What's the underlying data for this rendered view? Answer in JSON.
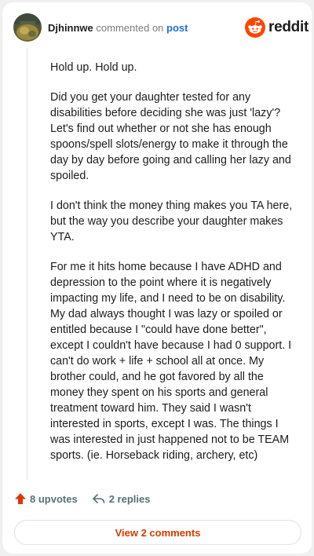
{
  "header": {
    "username": "Djhinnwe",
    "action_text": "commented on",
    "post_link": "post",
    "brand": "reddit"
  },
  "comment": {
    "paragraphs": [
      "Hold up. Hold up.",
      "Did you get your daughter tested for any disabilities before deciding she was just 'lazy'? Let's find out whether or not she has enough spoons/spell slots/energy to make it through the day by day before going and calling her lazy and spoiled.",
      "I don't think the money thing makes you TA here, but the way you describe your daughter makes YTA.",
      "For me it hits home because I have ADHD and depression to the point where it is negatively impacting my life, and I need to be on disability. My dad always thought I was lazy or spoiled or entitled because I \"could have done better\", except I couldn't have because I had 0 support. I can't do work + life + school all at once. My brother could, and he got favored by all the money they spent on his sports and general treatment toward him. They said I wasn't interested in sports, except I was. The things I was interested in just happened not to be TEAM sports. (ie. Horseback riding, archery, etc)"
    ]
  },
  "actions": {
    "upvotes": "8 upvotes",
    "replies": "2 replies"
  },
  "footer": {
    "view_comments": "View 2 comments"
  },
  "colors": {
    "brand_orange": "#ff4500",
    "upvote": "#d93900",
    "link_blue": "#1f6fd6"
  }
}
